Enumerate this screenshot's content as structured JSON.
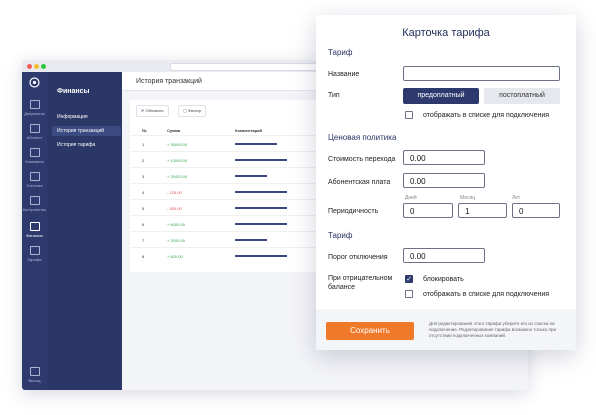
{
  "colors": {
    "accent": "#f07a2a",
    "navy": "#2e3a6e",
    "positive": "#2ea84a",
    "negative": "#e04848"
  },
  "app": {
    "section_title": "Финансы",
    "page_title": "История транзакций",
    "rail": [
      {
        "icon": "documents-icon",
        "label": "Документы"
      },
      {
        "icon": "person-icon",
        "label": "Абонент"
      },
      {
        "icon": "bag-icon",
        "label": "Компания"
      },
      {
        "icon": "box-icon",
        "label": "Система"
      },
      {
        "icon": "contract-icon",
        "label": "Контрагенты"
      },
      {
        "icon": "wallet-icon",
        "label": "Финансы"
      },
      {
        "icon": "tariff-icon",
        "label": "Тарифы"
      }
    ],
    "logout_label": "Выход",
    "submenu": [
      "Информация",
      "История транзакций",
      "История тарифа"
    ],
    "toolbar": {
      "refresh": "Обновить",
      "filter": "Фильтр"
    },
    "table": {
      "headers": [
        "№",
        "Сумма",
        "Комментарий"
      ],
      "rows": [
        {
          "num": "1",
          "amount": "+ 30000.00",
          "sign": "pos"
        },
        {
          "num": "2",
          "amount": "+ 10000.00",
          "sign": "pos"
        },
        {
          "num": "3",
          "amount": "+ 25420.00",
          "sign": "pos"
        },
        {
          "num": "4",
          "amount": "- 125.00",
          "sign": "neg"
        },
        {
          "num": "5",
          "amount": "- 300.00",
          "sign": "neg"
        },
        {
          "num": "6",
          "amount": "+ 6000.00",
          "sign": "pos"
        },
        {
          "num": "7",
          "amount": "+ 2000.00",
          "sign": "pos"
        },
        {
          "num": "8",
          "amount": "+ 620.00",
          "sign": "pos"
        }
      ]
    }
  },
  "dialog": {
    "title": "Карточка тарифа",
    "section_tariff": "Тариф",
    "name_label": "Название",
    "name_value": "",
    "type_label": "Тип",
    "type_prepaid": "предоплатный",
    "type_postpaid": "постоплатный",
    "show_in_list": "отображать в списке для подключения",
    "section_price": "Ценовая политика",
    "transition_cost_label": "Стоимость перехода",
    "transition_cost": "0.00",
    "subscription_fee_label": "Абонентская плата",
    "subscription_fee": "0.00",
    "periodicity_label": "Периодичность",
    "days_label": "Дней",
    "months_label": "Месяц",
    "years_label": "Лет",
    "days": "0",
    "months": "1",
    "years": "0",
    "section_tariff2": "Тариф",
    "disconnect_label": "Порог отключения",
    "disconnect_value": "0.00",
    "negative_label_1": "При отрицательном",
    "negative_label_2": "балансе",
    "block_label": "блокировать",
    "show_in_list_2": "отображать в списке для подключения",
    "save_label": "Сохранить",
    "note": "Для редактирования этого тарифа уберите его из списка на подключение. Редактирование тарифа возможно только при отсутствии подключенных компаний."
  }
}
